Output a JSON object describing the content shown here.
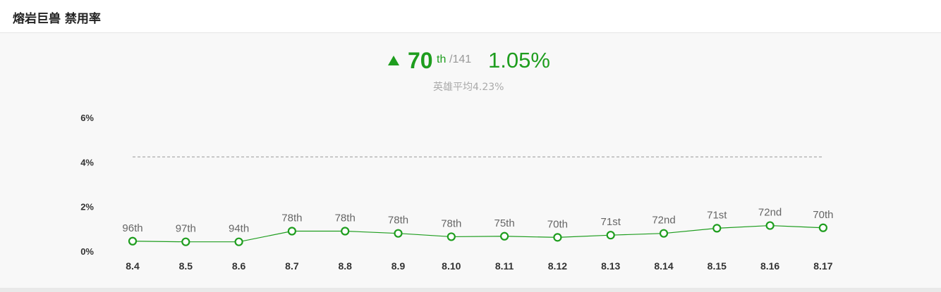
{
  "header": {
    "title": "熔岩巨兽 禁用率"
  },
  "summary": {
    "rank": "70",
    "rank_suffix": "th",
    "rank_total": "/141",
    "rate": "1.05%",
    "average_text": "英雄平均4.23%"
  },
  "colors": {
    "accent": "#1e9d1e",
    "average_line": "#999999"
  },
  "chart_data": {
    "type": "line",
    "categories": [
      "8.4",
      "8.5",
      "8.6",
      "8.7",
      "8.8",
      "8.9",
      "8.10",
      "8.11",
      "8.12",
      "8.13",
      "8.14",
      "8.15",
      "8.16",
      "8.17"
    ],
    "values": [
      0.45,
      0.42,
      0.42,
      0.9,
      0.9,
      0.8,
      0.65,
      0.67,
      0.62,
      0.72,
      0.8,
      1.03,
      1.15,
      1.05
    ],
    "point_labels": [
      "96th",
      "97th",
      "94th",
      "78th",
      "78th",
      "78th",
      "78th",
      "75th",
      "70th",
      "71st",
      "72nd",
      "71st",
      "72nd",
      "70th"
    ],
    "average": 4.23,
    "ylim": [
      0,
      6
    ],
    "yticks": [
      0,
      2,
      4,
      6
    ],
    "ytick_labels": [
      "0%",
      "2%",
      "4%",
      "6%"
    ],
    "grid": false,
    "title": "",
    "xlabel": "",
    "ylabel": ""
  }
}
